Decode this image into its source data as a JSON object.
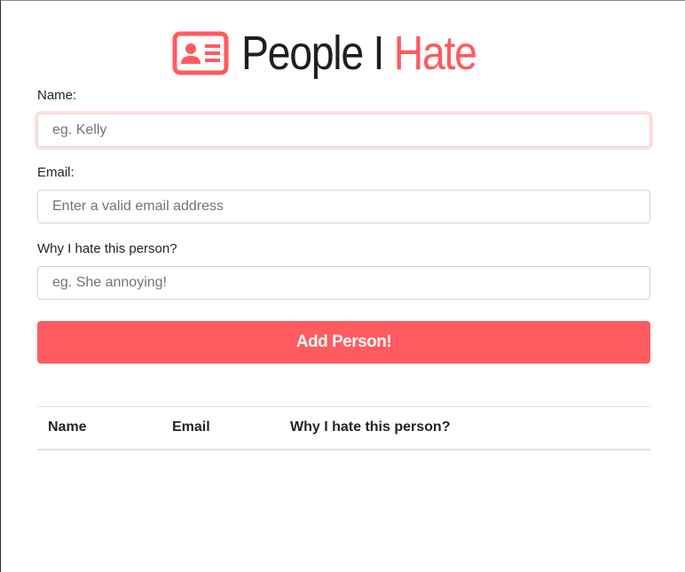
{
  "header": {
    "icon": "id-card-icon",
    "title_primary": "People I",
    "title_accent": "Hate"
  },
  "form": {
    "name": {
      "label": "Name:",
      "placeholder": "eg. Kelly",
      "value": ""
    },
    "email": {
      "label": "Email:",
      "placeholder": "Enter a valid email address",
      "value": ""
    },
    "reason": {
      "label": "Why I hate this person?",
      "placeholder": "eg. She annoying!",
      "value": ""
    },
    "submit_label": "Add Person!"
  },
  "table": {
    "headers": [
      "Name",
      "Email",
      "Why I hate this person?"
    ],
    "rows": []
  },
  "colors": {
    "accent": "#ff5a5f",
    "text": "#212529",
    "border": "#ced4da"
  }
}
